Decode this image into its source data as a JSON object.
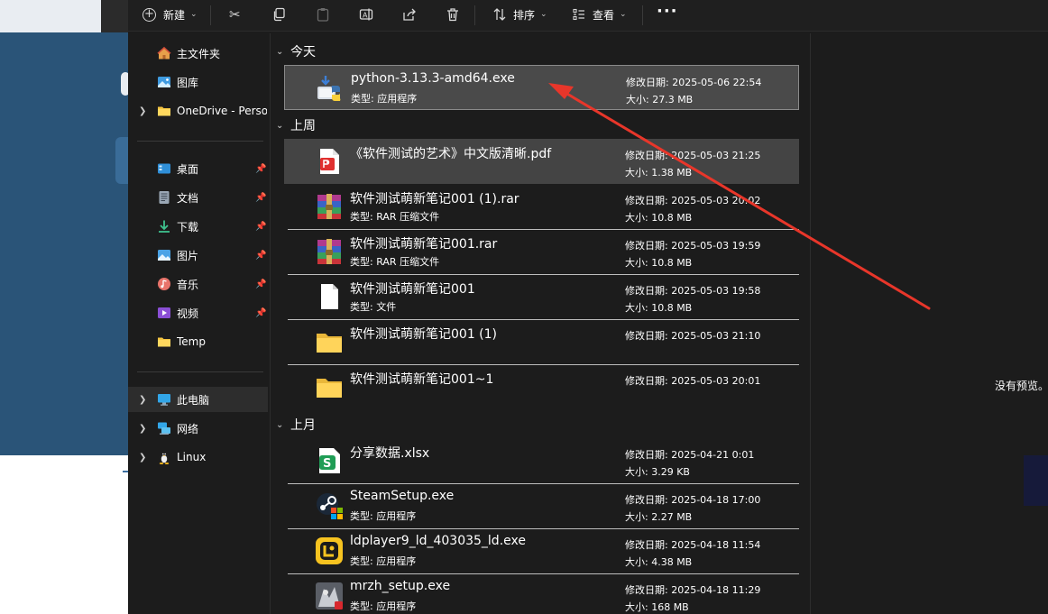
{
  "toolbar": {
    "new_label": "新建",
    "sort_label": "排序",
    "view_label": "查看",
    "more_label": "..."
  },
  "sidebar": {
    "items": [
      {
        "label": "主文件夹"
      },
      {
        "label": "图库"
      },
      {
        "label": "OneDrive - Perso"
      },
      {
        "label": "桌面"
      },
      {
        "label": "文档"
      },
      {
        "label": "下载"
      },
      {
        "label": "图片"
      },
      {
        "label": "音乐"
      },
      {
        "label": "视频"
      },
      {
        "label": "Temp"
      },
      {
        "label": "此电脑"
      },
      {
        "label": "网络"
      },
      {
        "label": "Linux"
      }
    ]
  },
  "groups": {
    "today": "今天",
    "last_week": "上周",
    "last_month": "上月"
  },
  "files": [
    {
      "name": "python-3.13.3-amd64.exe",
      "type": "类型: 应用程序",
      "date": "修改日期: 2025-05-06 22:54",
      "size": "大小: 27.3 MB"
    },
    {
      "name": "《软件测试的艺术》中文版清晰.pdf",
      "type": "",
      "date": "修改日期: 2025-05-03 21:25",
      "size": "大小: 1.38 MB"
    },
    {
      "name": "软件测试萌新笔记001 (1).rar",
      "type": "类型: RAR 压缩文件",
      "date": "修改日期: 2025-05-03 20:02",
      "size": "大小: 10.8 MB"
    },
    {
      "name": "软件测试萌新笔记001.rar",
      "type": "类型: RAR 压缩文件",
      "date": "修改日期: 2025-05-03 19:59",
      "size": "大小: 10.8 MB"
    },
    {
      "name": "软件测试萌新笔记001",
      "type": "类型: 文件",
      "date": "修改日期: 2025-05-03 19:58",
      "size": "大小: 10.8 MB"
    },
    {
      "name": "软件测试萌新笔记001 (1)",
      "type": "",
      "date": "修改日期: 2025-05-03 21:10",
      "size": ""
    },
    {
      "name": "软件测试萌新笔记001~1",
      "type": "",
      "date": "修改日期: 2025-05-03 20:01",
      "size": ""
    },
    {
      "name": "分享数据.xlsx",
      "type": "",
      "date": "修改日期: 2025-04-21 0:01",
      "size": "大小: 3.29 KB"
    },
    {
      "name": "SteamSetup.exe",
      "type": "类型: 应用程序",
      "date": "修改日期: 2025-04-18 17:00",
      "size": "大小: 2.27 MB"
    },
    {
      "name": "ldplayer9_ld_403035_ld.exe",
      "type": "类型: 应用程序",
      "date": "修改日期: 2025-04-18 11:54",
      "size": "大小: 4.38 MB"
    },
    {
      "name": "mrzh_setup.exe",
      "type": "类型: 应用程序",
      "date": "修改日期: 2025-04-18 11:29",
      "size": "大小: 168 MB"
    }
  ],
  "preview": {
    "message": "没有预览。"
  },
  "colors": {
    "accent_arrow": "#e8362a",
    "window_bg": "#1c1c1c",
    "selection": "#4a4a4a"
  }
}
